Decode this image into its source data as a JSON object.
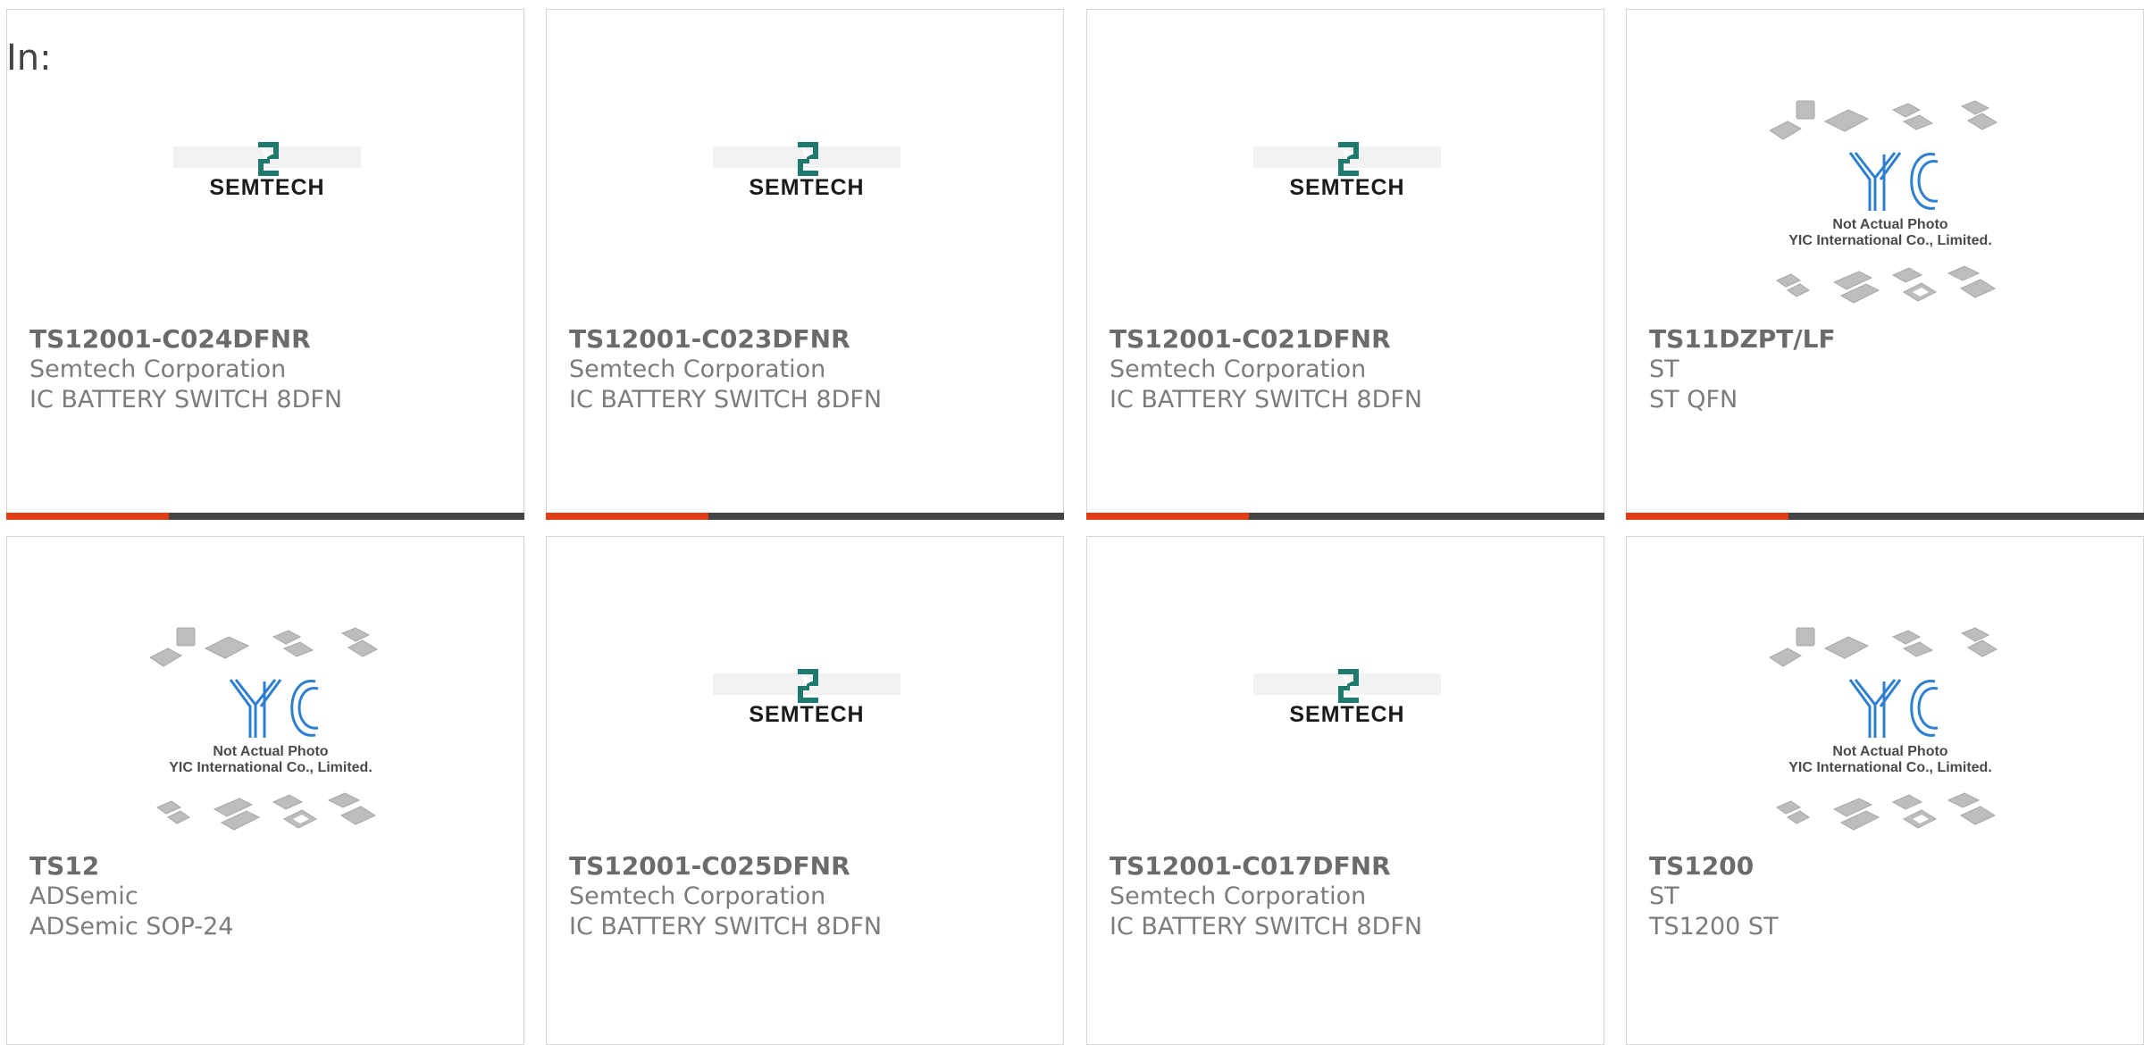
{
  "header": {
    "in_label": "In:"
  },
  "colors": {
    "accent": "#e03c16",
    "bar": "#444444",
    "semtech_teal": "#1f7a6e",
    "yic_blue": "#2e7fd0"
  },
  "products": [
    {
      "part": "TS12001-C024DFNR",
      "maker": "Semtech Corporation",
      "desc": "IC BATTERY SWITCH 8DFN",
      "image": "semtech-logo"
    },
    {
      "part": "TS12001-C023DFNR",
      "maker": "Semtech Corporation",
      "desc": "IC BATTERY SWITCH 8DFN",
      "image": "semtech-logo"
    },
    {
      "part": "TS12001-C021DFNR",
      "maker": "Semtech Corporation",
      "desc": "IC BATTERY SWITCH 8DFN",
      "image": "semtech-logo"
    },
    {
      "part": "TS11DZPT/LF",
      "maker": "ST",
      "desc": "ST QFN",
      "image": "yic-placeholder"
    },
    {
      "part": "TS12",
      "maker": "ADSemic",
      "desc": "ADSemic SOP-24",
      "image": "yic-placeholder"
    },
    {
      "part": "TS12001-C025DFNR",
      "maker": "Semtech Corporation",
      "desc": "IC BATTERY SWITCH 8DFN",
      "image": "semtech-logo"
    },
    {
      "part": "TS12001-C017DFNR",
      "maker": "Semtech Corporation",
      "desc": "IC BATTERY SWITCH 8DFN",
      "image": "semtech-logo"
    },
    {
      "part": "TS1200",
      "maker": "ST",
      "desc": "TS1200 ST",
      "image": "yic-placeholder"
    }
  ],
  "logos": {
    "semtech_text": "SEMTECH",
    "yic_caption_1": "Not Actual Photo",
    "yic_caption_2": "YIC International Co., Limited."
  }
}
